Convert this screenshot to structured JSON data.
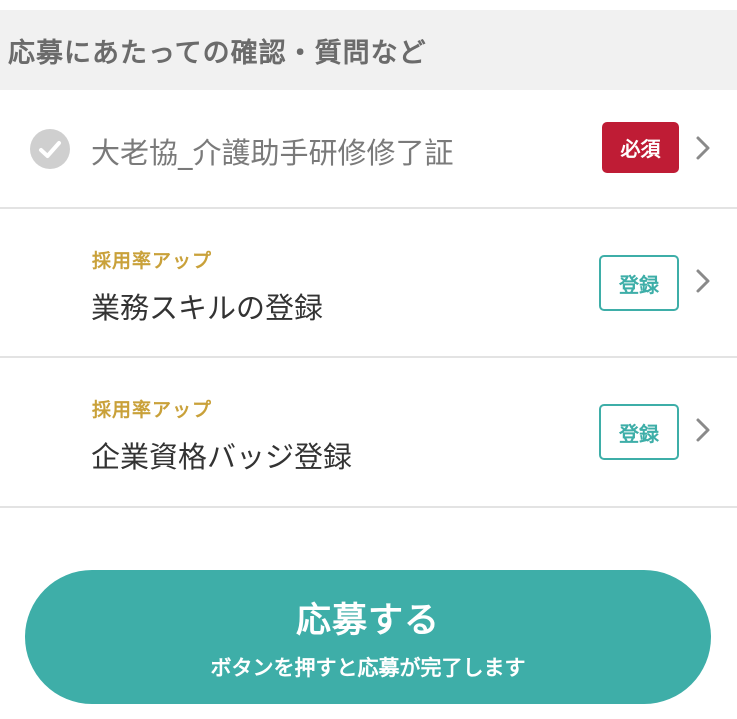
{
  "section": {
    "title": "応募にあたっての確認・質問など"
  },
  "items": [
    {
      "label": "大老協_介護助手研修修了証",
      "badge": "必須",
      "completed": true
    },
    {
      "boost": "採用率アップ",
      "label": "業務スキルの登録",
      "badge": "登録"
    },
    {
      "boost": "採用率アップ",
      "label": "企業資格バッジ登録",
      "badge": "登録"
    }
  ],
  "apply": {
    "label": "応募する",
    "sublabel": "ボタンを押すと応募が完了します"
  },
  "colors": {
    "accent": "#3eaea8",
    "required": "#bf1c35",
    "boost": "#c9a13a",
    "header_bg": "#f1f1f1"
  }
}
